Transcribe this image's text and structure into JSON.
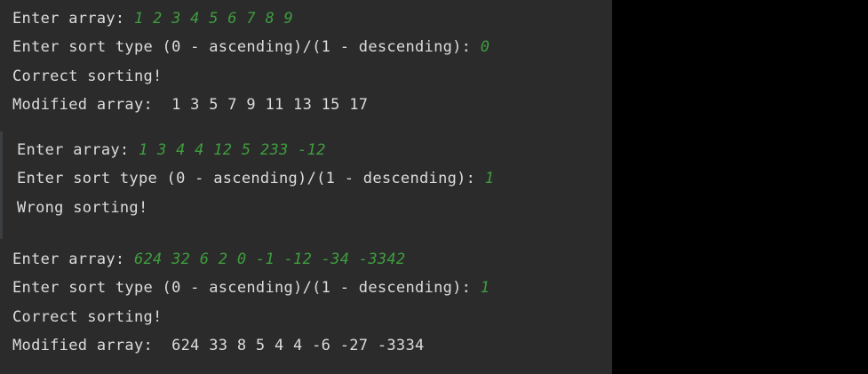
{
  "console": {
    "blocks": [
      {
        "lines": [
          {
            "prompt": "Enter array: ",
            "input": "1 2 3 4 5 6 7 8 9"
          },
          {
            "prompt": "Enter sort type (0 - ascending)/(1 - descending): ",
            "input": "0"
          },
          {
            "prompt": "Correct sorting!",
            "input": ""
          },
          {
            "prompt": "Modified array:  1 3 5 7 9 11 13 15 17",
            "input": ""
          }
        ]
      },
      {
        "lines": [
          {
            "prompt": "Enter array: ",
            "input": "1 3 4 4 12 5 233 -12"
          },
          {
            "prompt": "Enter sort type (0 - ascending)/(1 - descending): ",
            "input": "1"
          },
          {
            "prompt": "Wrong sorting!",
            "input": ""
          }
        ]
      },
      {
        "lines": [
          {
            "prompt": "Enter array: ",
            "input": "624 32 6 2 0 -1 -12 -34 -3342"
          },
          {
            "prompt": "Enter sort type (0 - ascending)/(1 - descending): ",
            "input": "1"
          },
          {
            "prompt": "Correct sorting!",
            "input": ""
          },
          {
            "prompt": "Modified array:  624 33 8 5 4 4 -6 -27 -3334",
            "input": ""
          }
        ]
      }
    ]
  },
  "colors": {
    "background": "#2b2b2b",
    "text": "#dcdcdc",
    "user_input": "#3f9d3f"
  }
}
